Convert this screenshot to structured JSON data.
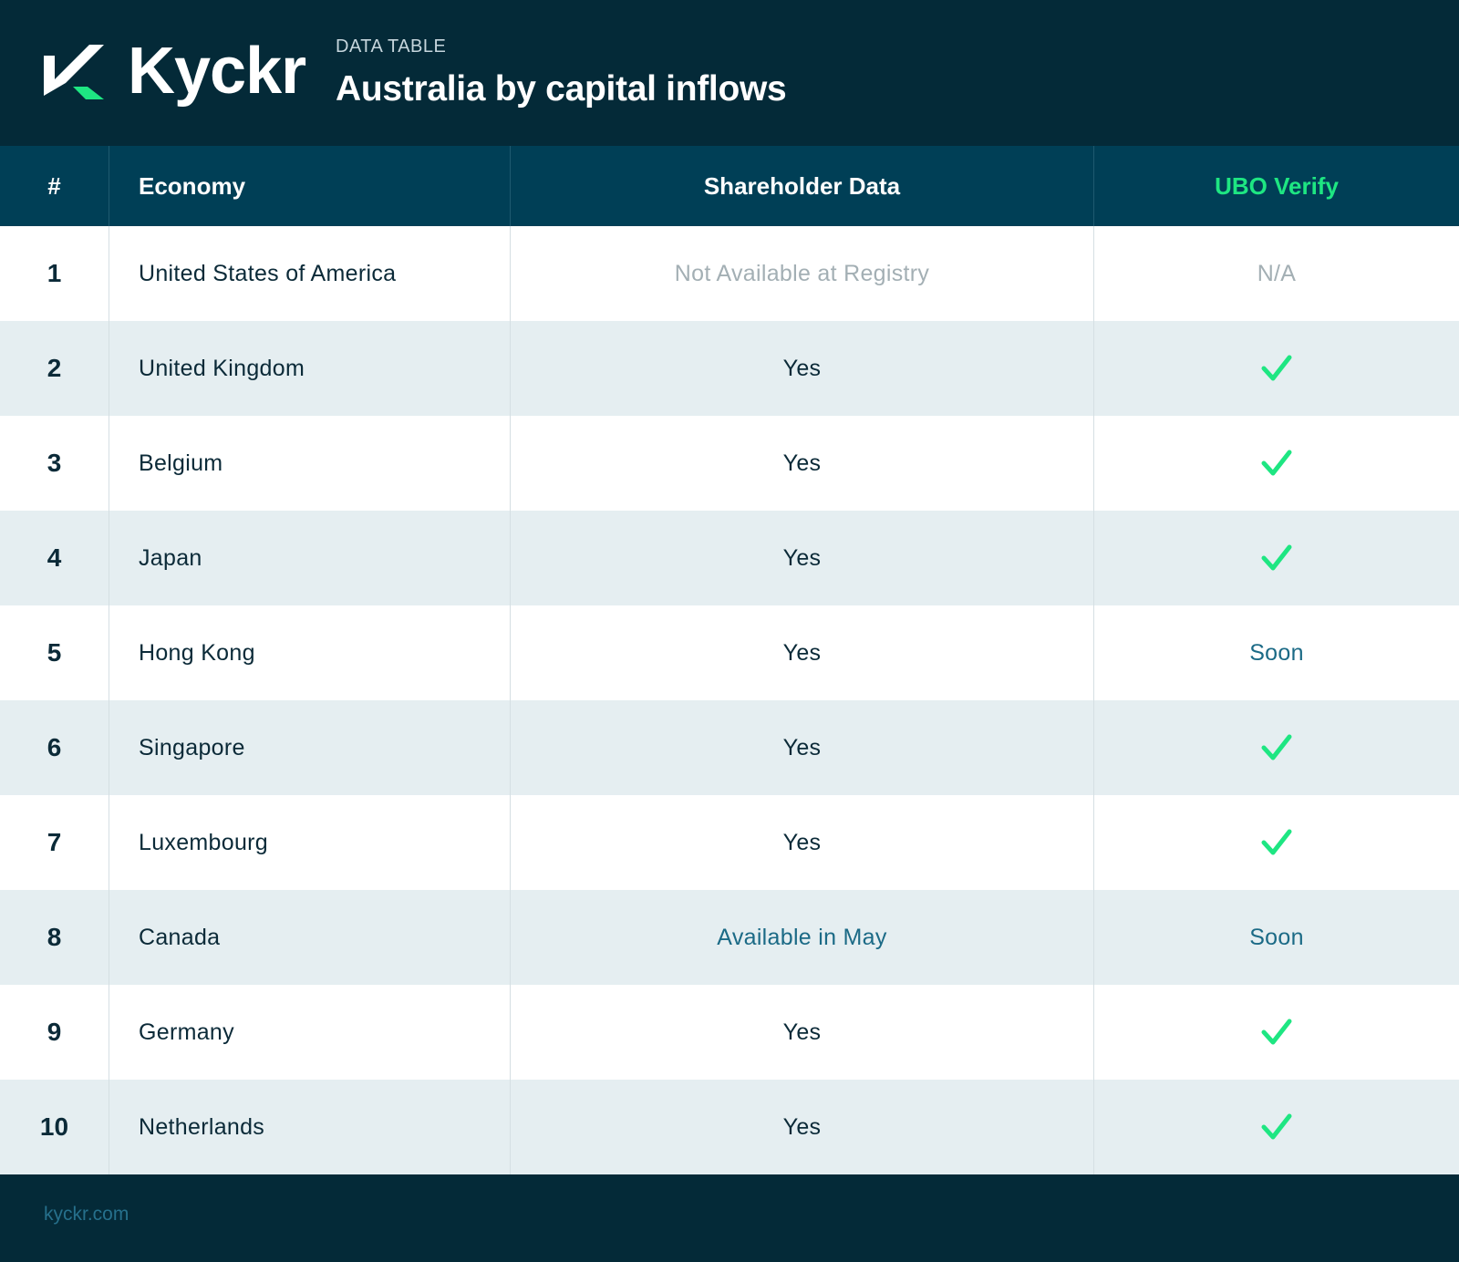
{
  "header": {
    "brand": "Kyckr",
    "eyebrow": "DATA TABLE",
    "title": "Australia by capital inflows"
  },
  "colors": {
    "navy": "#042a38",
    "table_header": "#003f56",
    "accent_green": "#1ee682",
    "stripe": "#e5eef1",
    "muted_text": "#a3afb4",
    "teal_text": "#1b6a86"
  },
  "table": {
    "columns": [
      "#",
      "Economy",
      "Shareholder Data",
      "UBO Verify"
    ],
    "rows": [
      {
        "num": "1",
        "economy": "United States of America",
        "shareholder": "Not Available at Registry",
        "shareholder_style": "muted",
        "ubo": "N/A",
        "ubo_style": "muted"
      },
      {
        "num": "2",
        "economy": "United Kingdom",
        "shareholder": "Yes",
        "shareholder_style": "normal",
        "ubo": "check-icon",
        "ubo_style": "check"
      },
      {
        "num": "3",
        "economy": "Belgium",
        "shareholder": "Yes",
        "shareholder_style": "normal",
        "ubo": "check-icon",
        "ubo_style": "check"
      },
      {
        "num": "4",
        "economy": "Japan",
        "shareholder": "Yes",
        "shareholder_style": "normal",
        "ubo": "check-icon",
        "ubo_style": "check"
      },
      {
        "num": "5",
        "economy": "Hong Kong",
        "shareholder": "Yes",
        "shareholder_style": "normal",
        "ubo": "Soon",
        "ubo_style": "accent"
      },
      {
        "num": "6",
        "economy": "Singapore",
        "shareholder": "Yes",
        "shareholder_style": "normal",
        "ubo": "check-icon",
        "ubo_style": "check"
      },
      {
        "num": "7",
        "economy": "Luxembourg",
        "shareholder": "Yes",
        "shareholder_style": "normal",
        "ubo": "check-icon",
        "ubo_style": "check"
      },
      {
        "num": "8",
        "economy": "Canada",
        "shareholder": "Available in May",
        "shareholder_style": "accent",
        "ubo": "Soon",
        "ubo_style": "accent"
      },
      {
        "num": "9",
        "economy": "Germany",
        "shareholder": "Yes",
        "shareholder_style": "normal",
        "ubo": "check-icon",
        "ubo_style": "check"
      },
      {
        "num": "10",
        "economy": "Netherlands",
        "shareholder": "Yes",
        "shareholder_style": "normal",
        "ubo": "check-icon",
        "ubo_style": "check"
      }
    ]
  },
  "footer": {
    "site": "kyckr.com"
  }
}
